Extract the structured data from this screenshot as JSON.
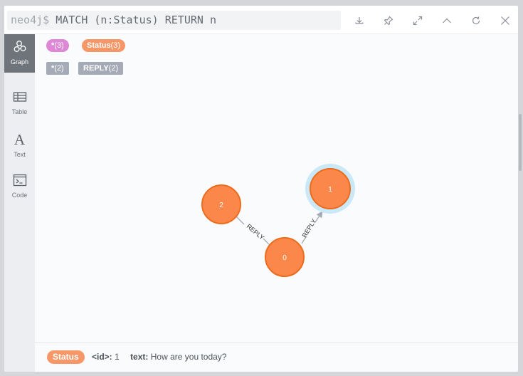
{
  "query": {
    "prompt": "neo4j$",
    "text": "MATCH (n:Status) RETURN n"
  },
  "header_buttons": [
    {
      "name": "download-icon"
    },
    {
      "name": "pin-icon"
    },
    {
      "name": "expand-icon"
    },
    {
      "name": "collapse-icon"
    },
    {
      "name": "refresh-icon"
    },
    {
      "name": "close-icon"
    }
  ],
  "sidebar": {
    "items": [
      {
        "label": "Graph",
        "icon": "graph-icon",
        "active": true
      },
      {
        "label": "Table",
        "icon": "table-icon"
      },
      {
        "label": "Text",
        "icon": "text-icon"
      },
      {
        "label": "Code",
        "icon": "code-icon"
      }
    ]
  },
  "legend": {
    "node_labels": [
      {
        "label": "*",
        "count": "(3)",
        "color": "#de87d6"
      },
      {
        "label": "Status",
        "count": "(3)",
        "color": "#f79767"
      }
    ],
    "relationship_types": [
      {
        "label": "*",
        "count": "(2)",
        "color": "#a5abb6"
      },
      {
        "label": "REPLY",
        "count": "(2)",
        "color": "#a5abb6"
      }
    ]
  },
  "graph": {
    "nodes": [
      {
        "id": "0",
        "caption": "0",
        "label": "Status"
      },
      {
        "id": "1",
        "caption": "1",
        "label": "Status",
        "selected": true
      },
      {
        "id": "2",
        "caption": "2",
        "label": "Status"
      }
    ],
    "relationships": [
      {
        "from": "2",
        "to": "0",
        "type": "REPLY"
      },
      {
        "from": "0",
        "to": "1",
        "type": "REPLY"
      }
    ],
    "node_color": "#fb874b",
    "node_stroke": "#ec6c1b",
    "selection_color": "#c9e9f8",
    "edge_color": "#a5abb6"
  },
  "status_bar": {
    "label": "Status",
    "properties": [
      {
        "key": "<id>:",
        "value": "1"
      },
      {
        "key": "text:",
        "value": "How are you today?"
      }
    ]
  }
}
